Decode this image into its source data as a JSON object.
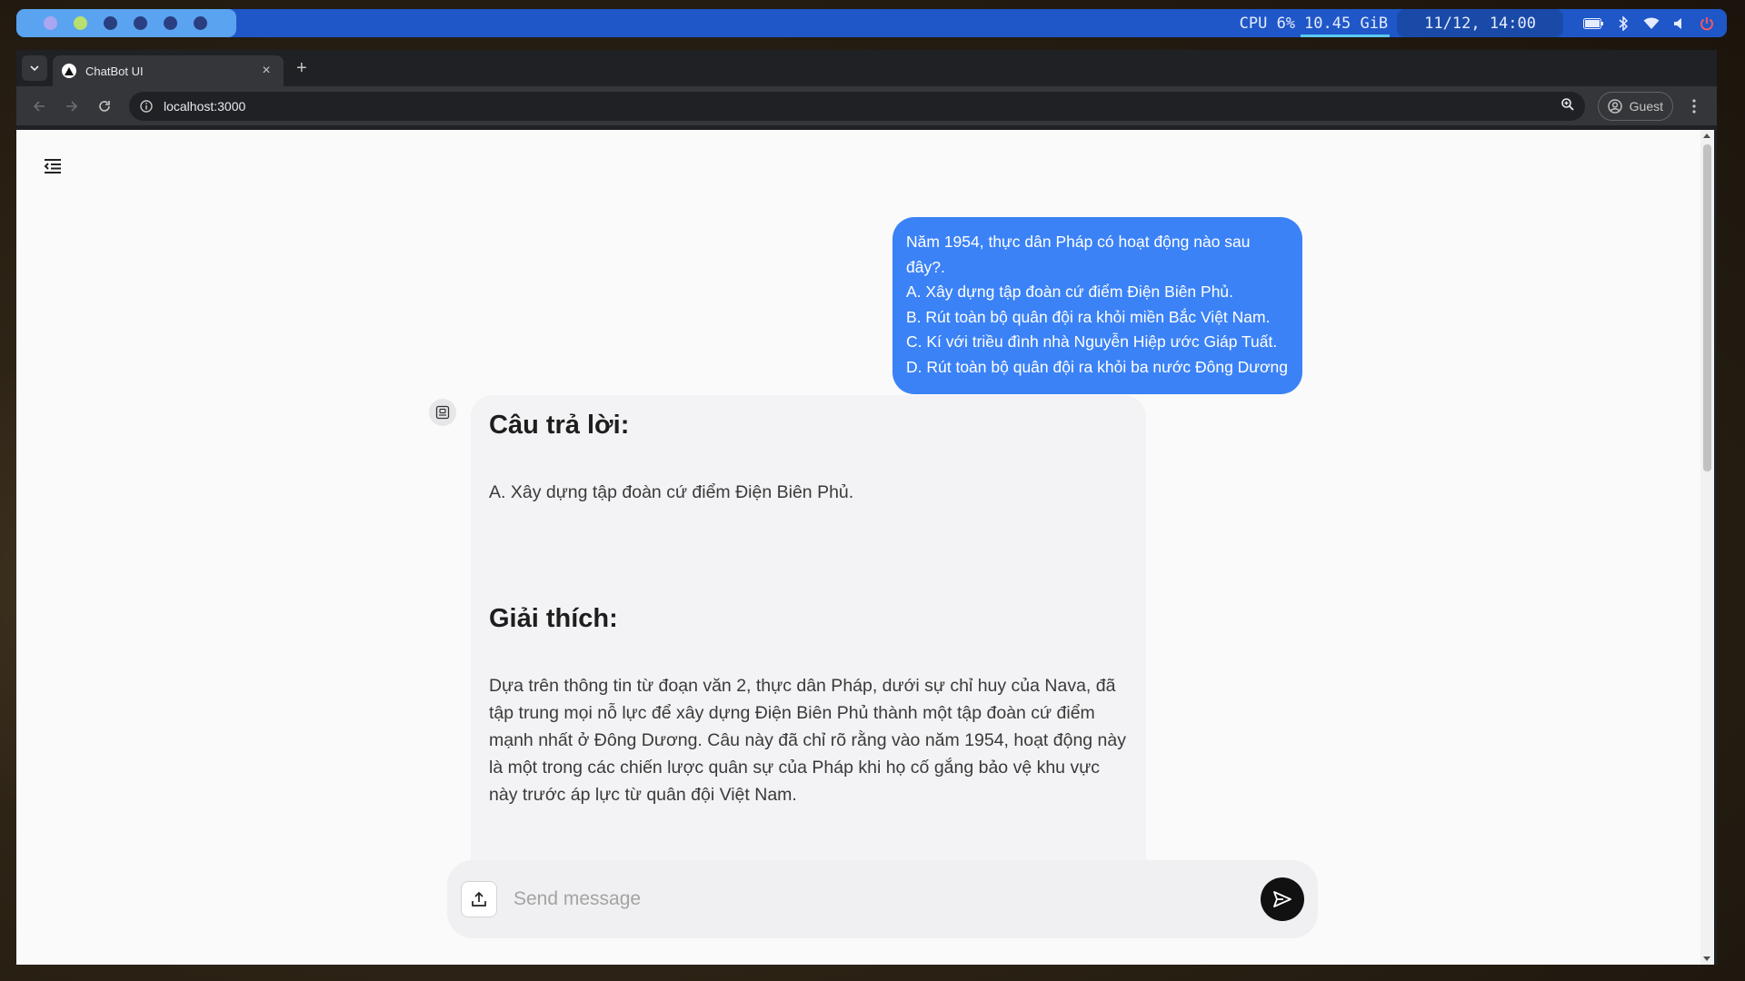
{
  "system_bar": {
    "cpu": "CPU 6%",
    "memory": "10.45 GiB",
    "datetime": "11/12, 14:00",
    "icons": [
      "battery-icon",
      "bluetooth-icon",
      "wifi-icon",
      "volume-icon",
      "power-icon"
    ]
  },
  "browser": {
    "tab_title": "ChatBot UI",
    "url": "localhost:3000",
    "profile_label": "Guest"
  },
  "chat": {
    "user_message": {
      "lines": [
        "Năm 1954, thực dân Pháp có hoạt động nào sau đây?.",
        "A. Xây dựng tập đoàn cứ điểm Điện Biên Phủ.",
        "B. Rút toàn bộ quân đội ra khỏi miền Bắc Việt Nam.",
        "C. Kí với triều đình nhà Nguyễn Hiệp ước Giáp Tuất.",
        "D. Rút toàn bộ quân đội ra khỏi ba nước Đông Dương"
      ]
    },
    "bot_message": {
      "answer_heading": "Câu trả lời:",
      "answer_text": "A. Xây dựng tập đoàn cứ điểm Điện Biên Phủ.",
      "explanation_heading": "Giải thích:",
      "explanation_text": "Dựa trên thông tin từ đoạn văn 2, thực dân Pháp, dưới sự chỉ huy của Nava, đã tập trung mọi nỗ lực để xây dựng Điện Biên Phủ thành một tập đoàn cứ điểm mạnh nhất ở Đông Dương. Câu này đã chỉ rõ rằng vào năm 1954, hoạt động này là một trong các chiến lược quân sự của Pháp khi họ cố gắng bảo vệ khu vực này trước áp lực từ quân đội Việt Nam."
    },
    "composer": {
      "placeholder": "Send message",
      "value": ""
    }
  },
  "colors": {
    "user_bubble": "#3b82f6",
    "bot_bubble": "#f3f3f5",
    "send_button": "#111111"
  }
}
